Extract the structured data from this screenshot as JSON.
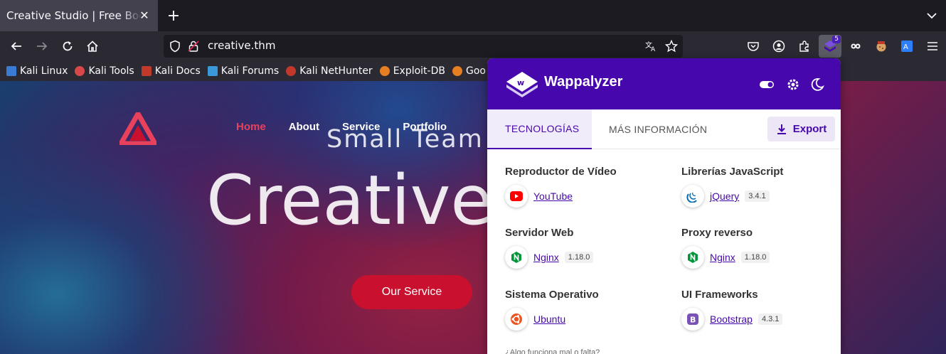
{
  "browser": {
    "tab": {
      "title": "Creative Studio | Free Bootstrap"
    },
    "url": "creative.thm",
    "extensions": {
      "wappalyzer_badge": "5"
    },
    "bookmarks": [
      {
        "label": "Kali Linux",
        "icon": "kali-dragon-icon",
        "color": "#3a7bd5"
      },
      {
        "label": "Kali Tools",
        "icon": "kali-tools-icon",
        "color": "#d94848"
      },
      {
        "label": "Kali Docs",
        "icon": "kali-docs-icon",
        "color": "#c0392b"
      },
      {
        "label": "Kali Forums",
        "icon": "kali-forums-icon",
        "color": "#3a9ad9"
      },
      {
        "label": "Kali NetHunter",
        "icon": "nethunter-icon",
        "color": "#c0392b"
      },
      {
        "label": "Exploit-DB",
        "icon": "exploit-db-icon",
        "color": "#e67e22"
      },
      {
        "label": "Goo",
        "icon": "ghdb-icon",
        "color": "#e67e22"
      }
    ]
  },
  "site": {
    "nav": [
      "Home",
      "About",
      "Service",
      "Portfolio"
    ],
    "hero_subtitle": "Small Team W",
    "hero_title": "Creative",
    "cta": "Our Service",
    "accent": "#c9102e"
  },
  "wappalyzer": {
    "title": "Wappalyzer",
    "brand_color": "#4608ad",
    "tabs": {
      "technologies": "TECNOLOGÍAS",
      "more_info": "MÁS INFORMACIÓN"
    },
    "export_label": "Export",
    "categories": [
      {
        "title": "Reproductor de Vídeo",
        "tech": {
          "name": "YouTube",
          "version": "",
          "icon": "youtube-icon"
        }
      },
      {
        "title": "Librerías JavaScript",
        "tech": {
          "name": "jQuery",
          "version": "3.4.1",
          "icon": "jquery-icon"
        }
      },
      {
        "title": "Servidor Web",
        "tech": {
          "name": "Nginx",
          "version": "1.18.0",
          "icon": "nginx-icon"
        }
      },
      {
        "title": "Proxy reverso",
        "tech": {
          "name": "Nginx",
          "version": "1.18.0",
          "icon": "nginx-icon"
        }
      },
      {
        "title": "Sistema Operativo",
        "tech": {
          "name": "Ubuntu",
          "version": "",
          "icon": "ubuntu-icon"
        }
      },
      {
        "title": "UI Frameworks",
        "tech": {
          "name": "Bootstrap",
          "version": "4.3.1",
          "icon": "bootstrap-icon"
        }
      }
    ],
    "footer": "¿Algo funciona mal o falta?"
  }
}
